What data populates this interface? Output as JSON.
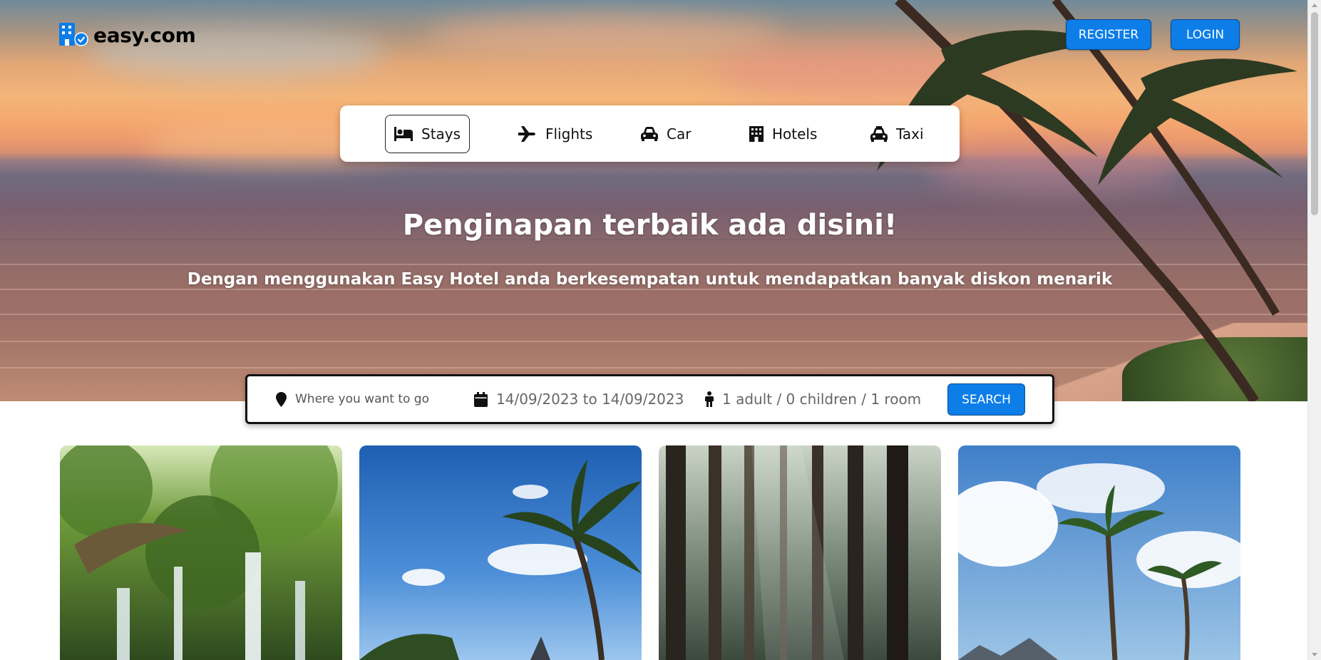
{
  "brand": {
    "name": "easy.com",
    "accent": "#0d7de8"
  },
  "header": {
    "register_label": "REGISTER",
    "login_label": "LOGIN"
  },
  "tabs": [
    {
      "label": "Stays",
      "icon": "bed-icon",
      "active": true
    },
    {
      "label": "Flights",
      "icon": "plane-icon",
      "active": false
    },
    {
      "label": "Car",
      "icon": "car-icon",
      "active": false
    },
    {
      "label": "Hotels",
      "icon": "building-icon",
      "active": false
    },
    {
      "label": "Taxi",
      "icon": "taxi-icon",
      "active": false
    }
  ],
  "hero": {
    "title": "Penginapan terbaik ada disini!",
    "subtitle": "Dengan menggunakan Easy Hotel anda berkesempatan untuk mendapatkan banyak diskon menarik"
  },
  "search": {
    "destination_placeholder": "Where you want to go",
    "date_range": "14/09/2023 to 14/09/2023",
    "guests": "1 adult / 0 children / 1 room",
    "button_label": "SEARCH"
  },
  "cards": [
    {
      "image": "waterfall-jungle"
    },
    {
      "image": "tropical-palm-beach"
    },
    {
      "image": "misty-forest"
    },
    {
      "image": "palm-trees-sky"
    }
  ]
}
